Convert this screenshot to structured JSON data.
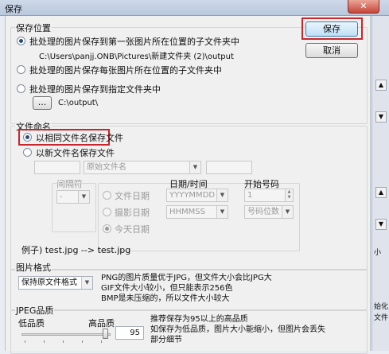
{
  "window": {
    "title": "保存",
    "close_glyph": "✕"
  },
  "buttons": {
    "save": "保存",
    "cancel": "取消"
  },
  "save_location": {
    "title": "保存位置",
    "option1": "批处理的图片保存到第一张图片所在位置的子文件夹中",
    "option1_path": "C:\\Users\\panjj.ONB\\Pictures\\新建文件夹 (2)\\output",
    "option2": "批处理的图片保存每张图片所在位置的子文件夹中",
    "option3": "批处理的图片保存到指定文件夹中",
    "browse": "...",
    "folder": "C:\\output\\"
  },
  "naming": {
    "title": "文件命名",
    "same_name": "以相同文件名保存文件",
    "new_name": "以新文件名保存文件",
    "original_name_combo": "原始文件名",
    "separator_title": "间隔符",
    "separator_value": "-",
    "date_file": "文件日期",
    "date_shot": "摄影日期",
    "date_today": "今天日期",
    "datetime_title": "日期/时间",
    "date_format": "YYYYMMDD",
    "time_format": "HHMMSS",
    "start_num_title": "开始号码",
    "start_num": "1",
    "digits": "号码位数 3",
    "example": "例子) test.jpg --> test.jpg"
  },
  "format": {
    "title": "图片格式",
    "value": "保持原文件格式",
    "desc1": "PNG的图片质量优于JPG，但文件大小会比JPG大",
    "desc2": "GIF文件大小较小，但只能表示256色",
    "desc3": "BMP是未压缩的，所以文件大小较大"
  },
  "jpeg": {
    "title": "JPEG品质",
    "low": "低品质",
    "high": "高品质",
    "quality": "95",
    "quality_level": 95,
    "desc1": "推荐保存为95以上的高品质",
    "desc2": "如保存为低品质，图片大小能缩小，但图片会丢失",
    "desc3": "部分细节"
  },
  "right_strip": {
    "l1": "小",
    "l2": "始化",
    "l3": "文件"
  },
  "colors": {
    "highlight": "#c8262c"
  }
}
